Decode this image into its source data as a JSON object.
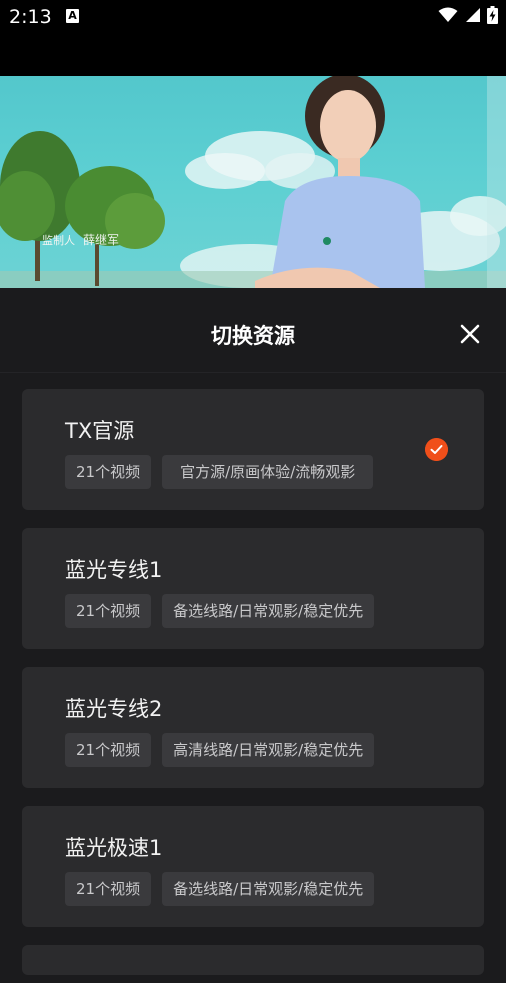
{
  "status": {
    "time": "2:13",
    "notification_icon": "A"
  },
  "video": {
    "caption_role": "监制人",
    "caption_name": "薛继军"
  },
  "sheet": {
    "title": "切换资源",
    "sources": [
      {
        "name": "TX官源",
        "count": "21个视频",
        "desc": "官方源/原画体验/流畅观影",
        "selected": true
      },
      {
        "name": "蓝光专线1",
        "count": "21个视频",
        "desc": "备选线路/日常观影/稳定优先",
        "selected": false
      },
      {
        "name": "蓝光专线2",
        "count": "21个视频",
        "desc": "高清线路/日常观影/稳定优先",
        "selected": false
      },
      {
        "name": "蓝光极速1",
        "count": "21个视频",
        "desc": "备选线路/日常观影/稳定优先",
        "selected": false
      }
    ]
  },
  "colors": {
    "accent": "#f04f1a",
    "card": "#2b2b2d",
    "tag": "#3a3a3d",
    "background": "#1b1b1d"
  }
}
